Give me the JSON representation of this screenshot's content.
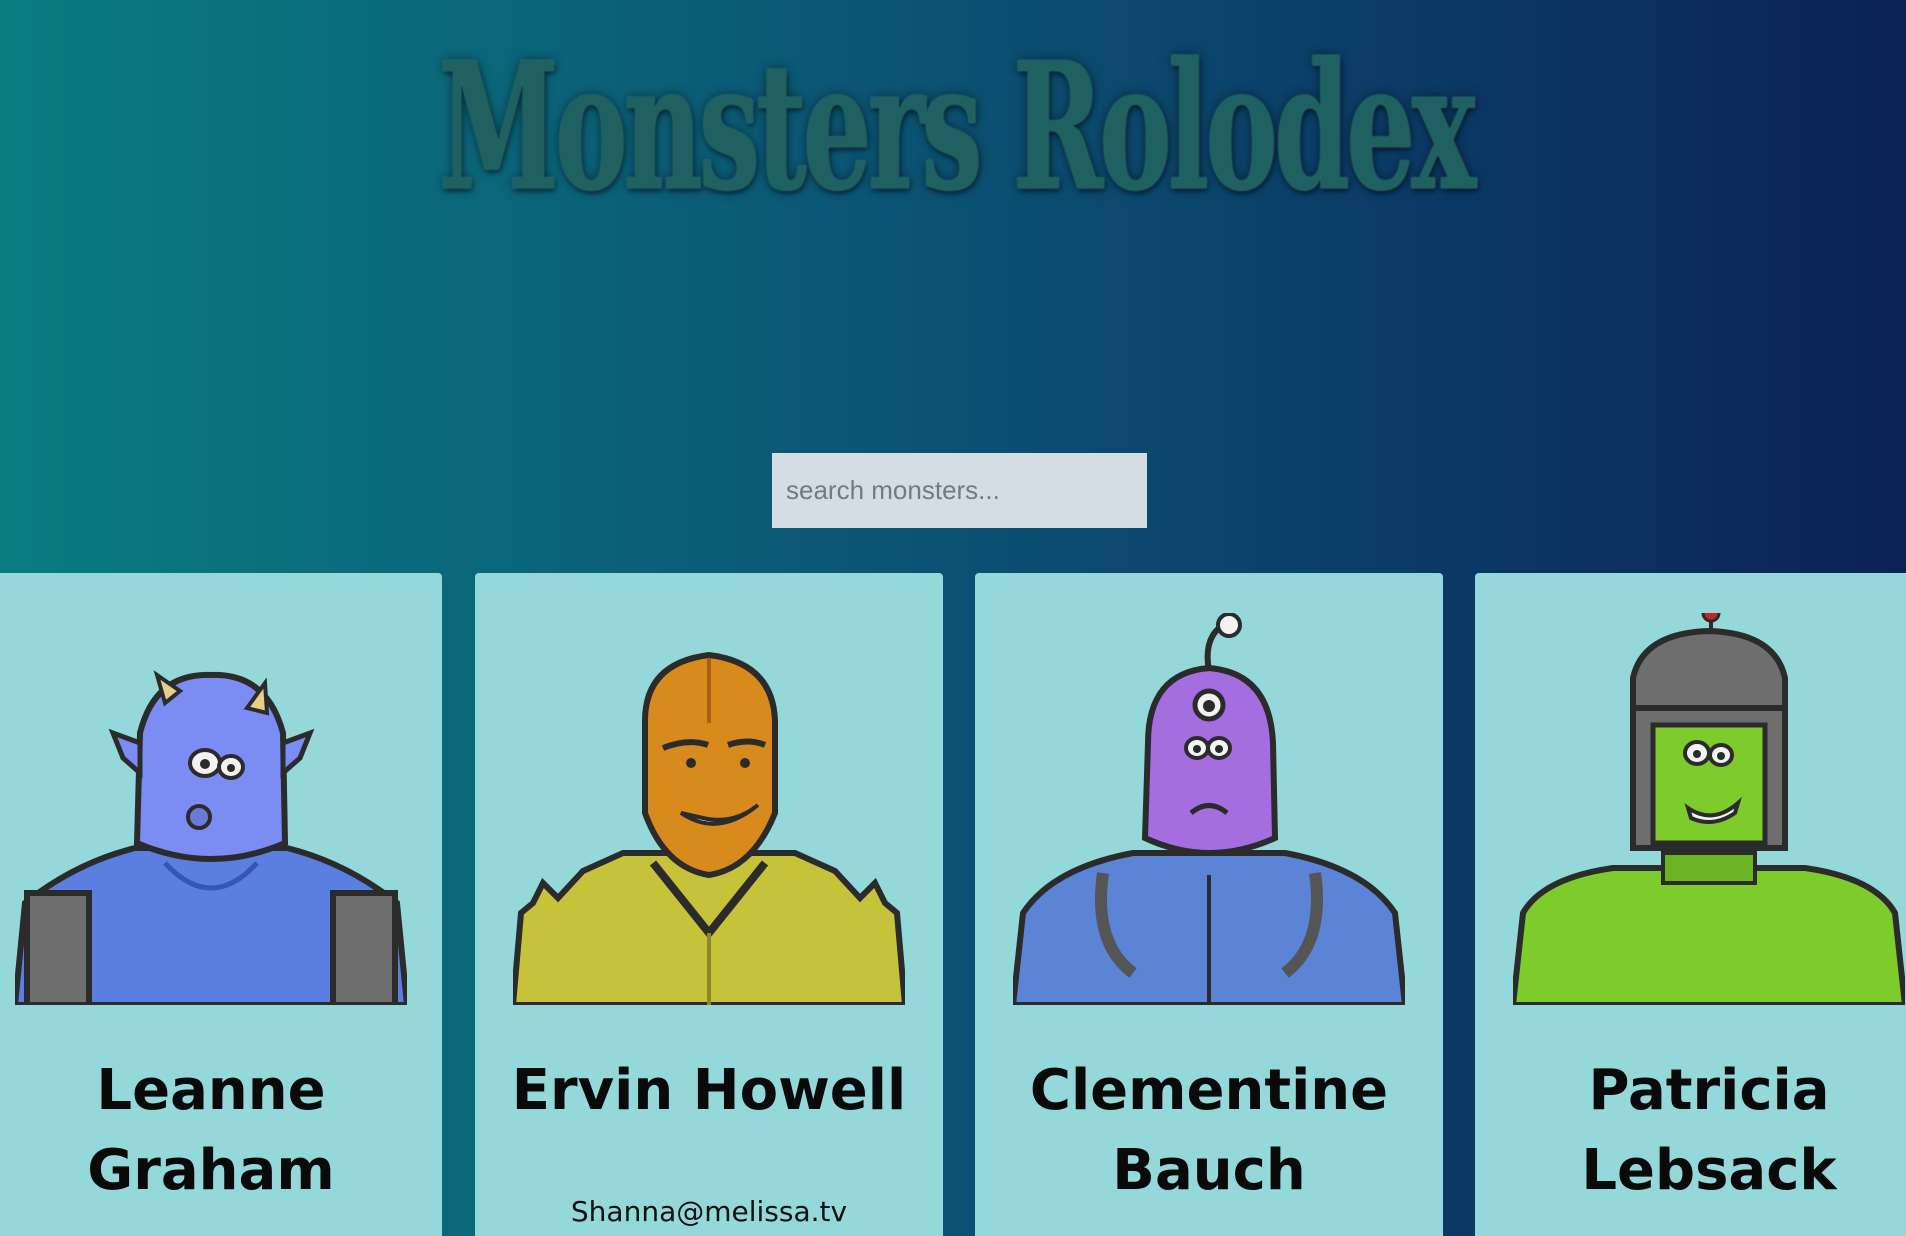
{
  "app": {
    "title": "Monsters Rolodex"
  },
  "search": {
    "placeholder": "search monsters...",
    "value": ""
  },
  "monsters": [
    {
      "name": "Leanne Graham",
      "email": "",
      "portrait": "blue-horned-monster-icon",
      "color": "#7b8cf2"
    },
    {
      "name": "Ervin Howell",
      "email": "Shanna@melissa.tv",
      "portrait": "orange-spiky-monster-icon",
      "color": "#d98a1c"
    },
    {
      "name": "Clementine Bauch",
      "email": "",
      "portrait": "purple-cyclops-robot-monster-icon",
      "color": "#a46ee0"
    },
    {
      "name": "Patricia Lebsack",
      "email": "",
      "portrait": "green-helmet-monster-icon",
      "color": "#7dcc2c"
    }
  ]
}
